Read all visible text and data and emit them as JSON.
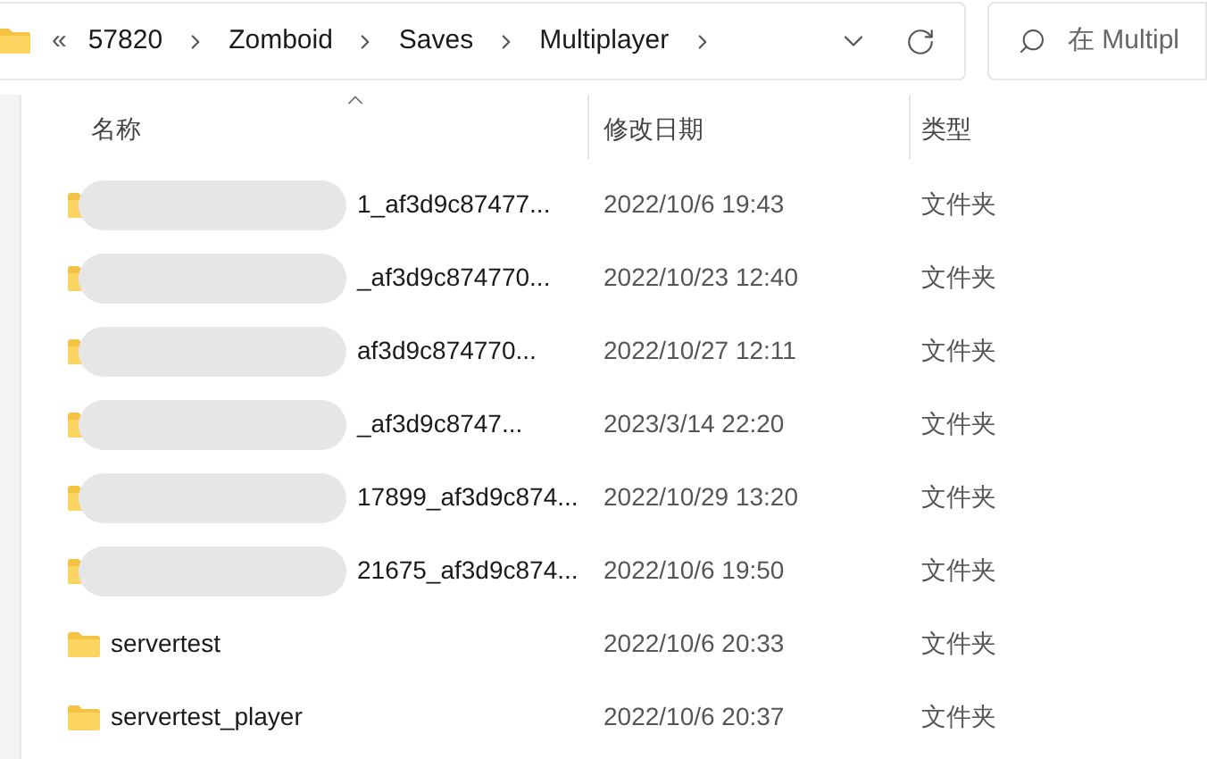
{
  "address_bar": {
    "overflow": "«",
    "crumbs": [
      "57820",
      "Zomboid",
      "Saves",
      "Multiplayer"
    ]
  },
  "search": {
    "placeholder": "在 Multipl"
  },
  "table": {
    "columns": [
      {
        "label": "名称",
        "sorted": true
      },
      {
        "label": "修改日期",
        "sorted": false
      },
      {
        "label": "类型",
        "sorted": false
      }
    ],
    "rows": [
      {
        "name": "1_af3d9c87477...",
        "redacted": true,
        "date": "2022/10/6 19:43",
        "type": "文件夹"
      },
      {
        "name": "_af3d9c874770...",
        "redacted": true,
        "date": "2022/10/23 12:40",
        "type": "文件夹"
      },
      {
        "name": "af3d9c874770...",
        "redacted": true,
        "date": "2022/10/27 12:11",
        "type": "文件夹"
      },
      {
        "name": "_af3d9c8747...",
        "redacted": true,
        "date": "2023/3/14 22:20",
        "type": "文件夹"
      },
      {
        "name": "17899_af3d9c874...",
        "redacted": true,
        "date": "2022/10/29 13:20",
        "type": "文件夹"
      },
      {
        "name": "21675_af3d9c874...",
        "redacted": true,
        "date": "2022/10/6 19:50",
        "type": "文件夹"
      },
      {
        "name": "servertest",
        "redacted": false,
        "date": "2022/10/6 20:33",
        "type": "文件夹"
      },
      {
        "name": "servertest_player",
        "redacted": false,
        "date": "2022/10/6 20:37",
        "type": "文件夹"
      }
    ]
  }
}
